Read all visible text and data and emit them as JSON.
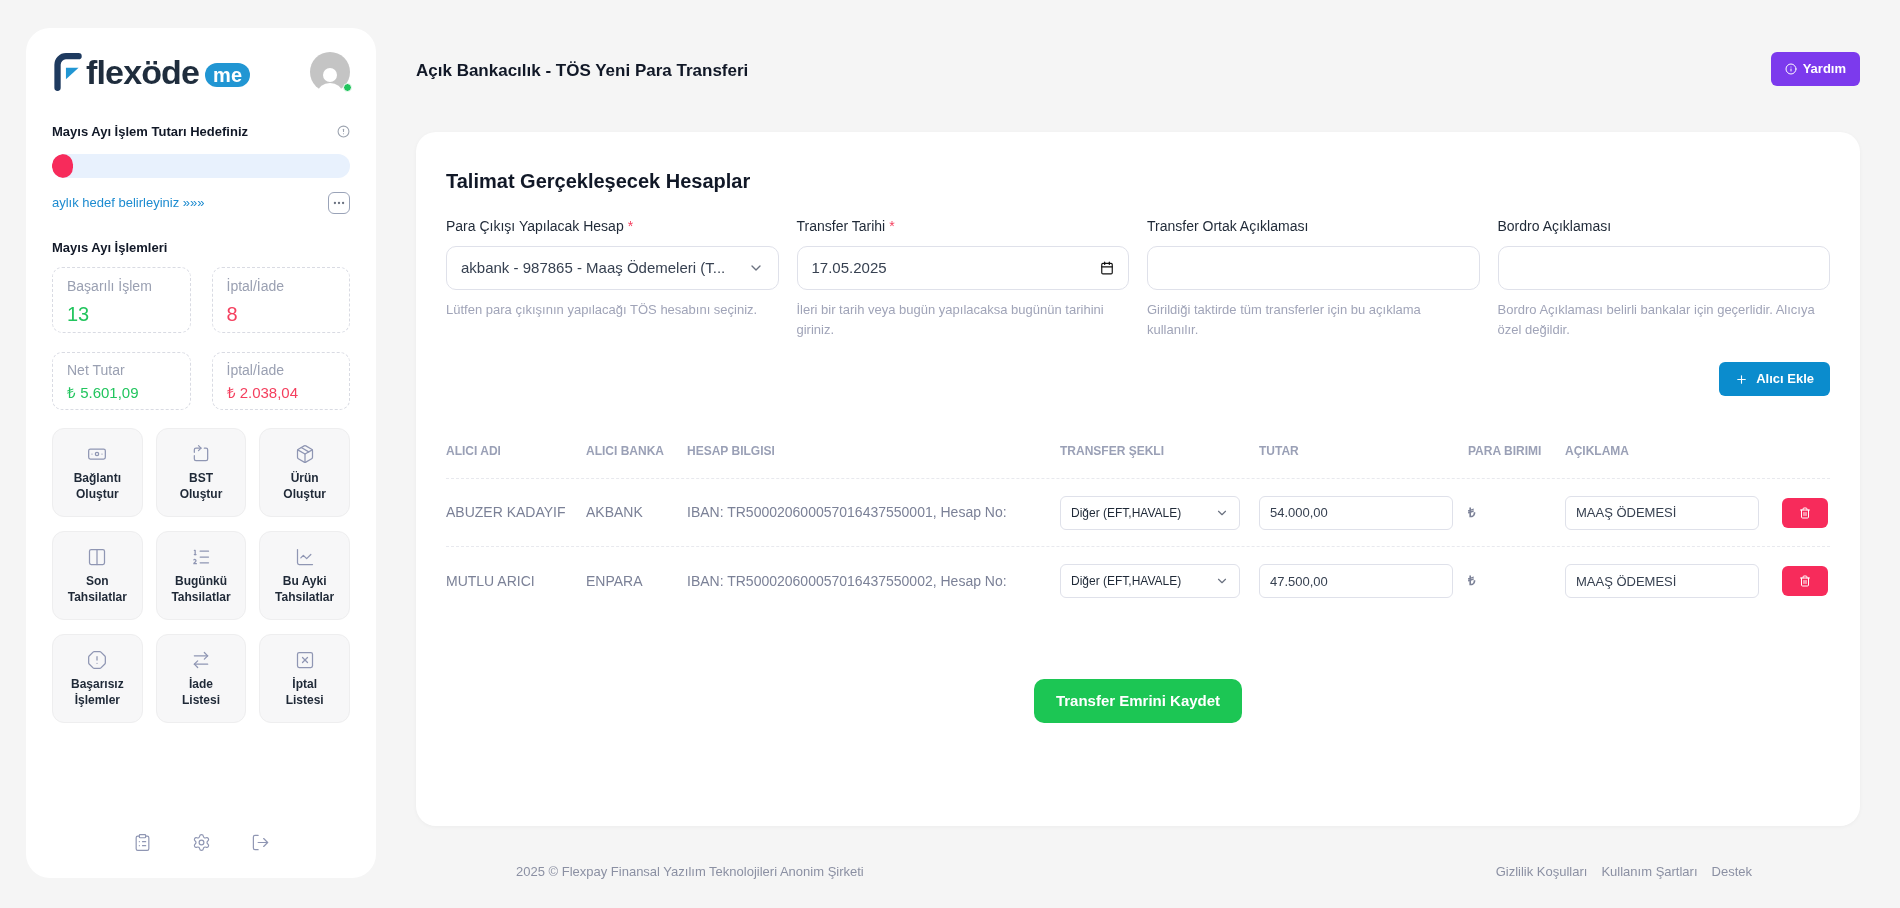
{
  "sidebar": {
    "logo": {
      "text": "flexöde",
      "suffix": "me"
    },
    "avatar": {
      "online": true
    },
    "goal": {
      "title": "Mayıs Ayı İşlem Tutarı Hedefiniz",
      "level": 0.07,
      "link": "aylık hedef belirleyiniz »»»"
    },
    "stats_title": "Mayıs Ayı İşlemleri",
    "stats": [
      {
        "label": "Başarılı İşlem",
        "value": "13",
        "color": "#22c55e"
      },
      {
        "label": "İptal/İade",
        "value": "8",
        "color": "#f43f5e"
      },
      {
        "label": "Net Tutar",
        "value": "₺ 5.601,09",
        "color": "#22c55e"
      },
      {
        "label": "İptal/İade",
        "value": "₺ 2.038,04",
        "color": "#f43f5e"
      }
    ],
    "shortcuts": [
      {
        "lines": [
          "Bağlantı",
          "Oluştur"
        ]
      },
      {
        "lines": [
          "BST",
          "Oluştur"
        ]
      },
      {
        "lines": [
          "Ürün",
          "Oluştur"
        ]
      },
      {
        "lines": [
          "Son",
          "Tahsilatlar"
        ]
      },
      {
        "lines": [
          "Bugünkü",
          "Tahsilatlar"
        ]
      },
      {
        "lines": [
          "Bu Ayki",
          "Tahsilatlar"
        ]
      },
      {
        "lines": [
          "Başarısız",
          "İşlemler"
        ]
      },
      {
        "lines": [
          "İade",
          "Listesi"
        ]
      },
      {
        "lines": [
          "İptal",
          "Listesi"
        ]
      }
    ]
  },
  "header": {
    "title": "Açık Bankacılık - TÖS Yeni Para Transferi",
    "help_button": "Yardım"
  },
  "card": {
    "title": "Talimat Gerçekleşecek Hesaplar",
    "fields": [
      {
        "kind": "select",
        "label": "Para Çıkışı Yapılacak Hesap",
        "required_mark": "*",
        "value": "akbank - 987865 - Maaş Ödemeleri (T...",
        "hint": "Lütfen para çıkışının yapılacağı TÖS hesabını seçiniz."
      },
      {
        "kind": "date",
        "label": "Transfer Tarihi",
        "required_mark": "*",
        "value": "17.05.2025",
        "hint": "İleri bir tarih veya bugün yapılacaksa bugünün tarihini giriniz."
      },
      {
        "kind": "text",
        "label": "Transfer Ortak Açıklaması",
        "hint": "Girildiği taktirde tüm transferler için bu açıklama kullanılır."
      },
      {
        "kind": "text",
        "label": "Bordro Açıklaması",
        "hint": "Bordro Açıklaması belirli bankalar için geçerlidir. Alıcıya özel değildir."
      }
    ],
    "add_button": "Alıcı Ekle",
    "table": {
      "columns": [
        "ALICI ADI",
        "ALICI BANKA",
        "HESAP BILGISI",
        "TRANSFER ŞEKLI",
        "TUTAR",
        "PARA BIRIMI",
        "AÇIKLAMA"
      ],
      "rows": [
        {
          "name": "ABUZER KADAYIF",
          "bank": "AKBANK",
          "account": "IBAN: TR500020600057016437550001, Hesap No:",
          "method": "Diğer (EFT,HAVALE)",
          "amount": "54.000,00",
          "currency": "₺",
          "description": "MAAŞ ÖDEMESİ"
        },
        {
          "name": "MUTLU ARICI",
          "bank": "ENPARA",
          "account": "IBAN: TR500020600057016437550002, Hesap No:",
          "method": "Diğer (EFT,HAVALE)",
          "amount": "47.500,00",
          "currency": "₺",
          "description": "MAAŞ ÖDEMESİ"
        }
      ]
    },
    "save_button": "Transfer Emrini Kaydet"
  },
  "footer": {
    "copyright": "2025 © Flexpay Finansal Yazılım Teknolojileri Anonim Şirketi",
    "links": [
      "Gizlilik Koşulları",
      "Kullanım Şartları",
      "Destek"
    ]
  }
}
